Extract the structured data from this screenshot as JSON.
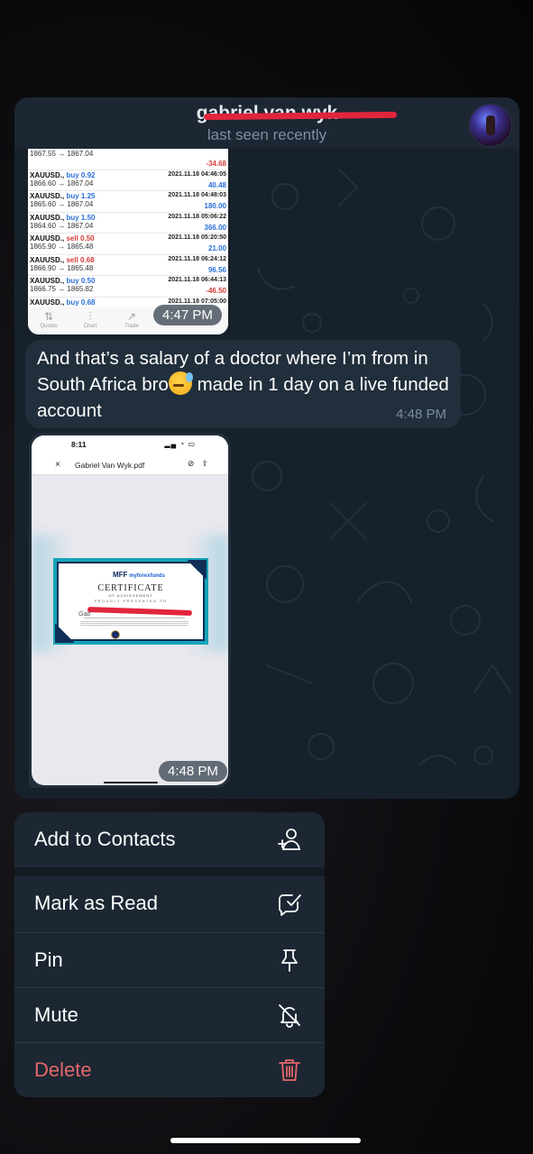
{
  "chat": {
    "contact_name": "gabriel van wyk",
    "status": "last seen recently",
    "trades_image": {
      "rows": [
        {
          "symbol": "",
          "action": "",
          "prices": "1867.55 → 1867.04",
          "date": "",
          "pnl": "-34.68"
        },
        {
          "symbol": "XAUUSD.,",
          "action": "buy 0.92",
          "prices": "1866.60 → 1867.04",
          "date": "2021.11.18 04:46:05",
          "pnl": "40.48"
        },
        {
          "symbol": "XAUUSD.,",
          "action": "buy 1.25",
          "prices": "1865.60 → 1867.04",
          "date": "2021.11.18 04:48:03",
          "pnl": "180.00"
        },
        {
          "symbol": "XAUUSD.,",
          "action": "buy 1.50",
          "prices": "1864.60 → 1867.04",
          "date": "2021.11.18 05:06:22",
          "pnl": "366.00"
        },
        {
          "symbol": "XAUUSD.,",
          "action": "sell 0.50",
          "prices": "1865.90 → 1865.48",
          "date": "2021.11.18 05:20:50",
          "pnl": "21.00"
        },
        {
          "symbol": "XAUUSD.,",
          "action": "sell 0.68",
          "prices": "1866.90 → 1865.48",
          "date": "2021.11.18 06:24:12",
          "pnl": "96.56"
        },
        {
          "symbol": "XAUUSD.,",
          "action": "buy 0.50",
          "prices": "1866.75 → 1865.82",
          "date": "2021.11.18 06:44:13",
          "pnl": "-46.50"
        },
        {
          "symbol": "XAUUSD.,",
          "action": "buy 0.68",
          "prices": "",
          "date": "2021.11.18 07:05:00",
          "pnl": ""
        }
      ],
      "tabs": [
        "Quotes",
        "Chart",
        "Trade"
      ],
      "time": "4:47 PM"
    },
    "message": {
      "text_before_emoji": "And that’s a salary of a doctor where I’m from in South Africa bro",
      "text_after_emoji": " made in 1 day on a live funded account",
      "time": "4:48 PM"
    },
    "document": {
      "status_time": "8:11",
      "file_name": "Gabriel Van Wyk.pdf",
      "certificate": {
        "brand_name": "myforexfunds",
        "title": "CERTIFICATE",
        "subtitle": "OF ACHIEVEMENT",
        "presented": "PROUDLY PRESENTED TO",
        "name_fragment": "Gab"
      },
      "time": "4:48 PM"
    }
  },
  "menu": {
    "items": [
      {
        "label": "Add to Contacts",
        "icon": "add-contact-icon"
      },
      {
        "label": "Mark as Read",
        "icon": "mark-read-icon"
      },
      {
        "label": "Pin",
        "icon": "pin-icon"
      },
      {
        "label": "Mute",
        "icon": "mute-icon"
      },
      {
        "label": "Delete",
        "icon": "trash-icon",
        "color": "#e5676b"
      }
    ]
  }
}
